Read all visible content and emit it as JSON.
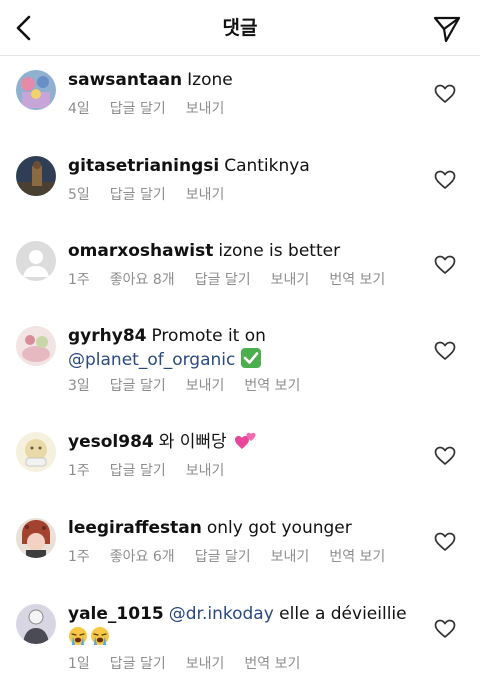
{
  "header": {
    "title": "댓글",
    "back_icon": "chevron-left-icon",
    "send_icon": "paper-plane-icon"
  },
  "colors": {
    "meta_gray": "#8e8e8e",
    "mention_blue": "#2a4a7f",
    "divider": "#e3e3e3"
  },
  "comments": [
    {
      "username": "sawsantaan",
      "text": "Izone",
      "time": "4일",
      "likes": "",
      "reply": "답글 달기",
      "send": "보내기",
      "translate": ""
    },
    {
      "username": "gitasetrianingsi",
      "text": "Cantiknya",
      "time": "5일",
      "likes": "",
      "reply": "답글 달기",
      "send": "보내기",
      "translate": ""
    },
    {
      "username": "omarxoshawist",
      "text": "izone is better",
      "time": "1주",
      "likes": "좋아요 8개",
      "reply": "답글 달기",
      "send": "보내기",
      "translate": "번역 보기"
    },
    {
      "username": "gyrhy84",
      "text": "Promote it on",
      "mention": "@planet_of_organic",
      "emoji": "check-mark-emoji",
      "time": "3일",
      "likes": "",
      "reply": "답글 달기",
      "send": "보내기",
      "translate": "번역 보기"
    },
    {
      "username": "yesol984",
      "text": "와 이뻐당",
      "emoji": "two-hearts-emoji",
      "time": "1주",
      "likes": "",
      "reply": "답글 달기",
      "send": "보내기",
      "translate": ""
    },
    {
      "username": "leegiraffestan",
      "text": "only got younger",
      "time": "1주",
      "likes": "좋아요 6개",
      "reply": "답글 달기",
      "send": "보내기",
      "translate": "번역 보기"
    },
    {
      "username": "yale_1015",
      "mention": "@dr.inkoday",
      "text": "elle a dévieillie",
      "emoji": "crying-face-emoji",
      "time": "1일",
      "likes": "",
      "reply": "답글 달기",
      "send": "보내기",
      "translate": "번역 보기"
    }
  ]
}
